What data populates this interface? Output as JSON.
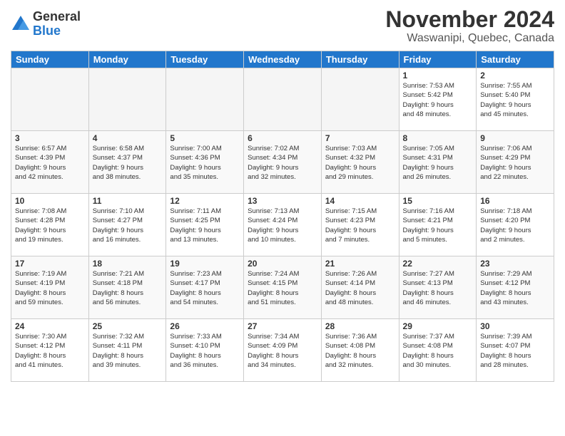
{
  "logo": {
    "general": "General",
    "blue": "Blue"
  },
  "title": "November 2024",
  "location": "Waswanipi, Quebec, Canada",
  "days_of_week": [
    "Sunday",
    "Monday",
    "Tuesday",
    "Wednesday",
    "Thursday",
    "Friday",
    "Saturday"
  ],
  "weeks": [
    [
      {
        "day": "",
        "info": ""
      },
      {
        "day": "",
        "info": ""
      },
      {
        "day": "",
        "info": ""
      },
      {
        "day": "",
        "info": ""
      },
      {
        "day": "",
        "info": ""
      },
      {
        "day": "1",
        "info": "Sunrise: 7:53 AM\nSunset: 5:42 PM\nDaylight: 9 hours\nand 48 minutes."
      },
      {
        "day": "2",
        "info": "Sunrise: 7:55 AM\nSunset: 5:40 PM\nDaylight: 9 hours\nand 45 minutes."
      }
    ],
    [
      {
        "day": "3",
        "info": "Sunrise: 6:57 AM\nSunset: 4:39 PM\nDaylight: 9 hours\nand 42 minutes."
      },
      {
        "day": "4",
        "info": "Sunrise: 6:58 AM\nSunset: 4:37 PM\nDaylight: 9 hours\nand 38 minutes."
      },
      {
        "day": "5",
        "info": "Sunrise: 7:00 AM\nSunset: 4:36 PM\nDaylight: 9 hours\nand 35 minutes."
      },
      {
        "day": "6",
        "info": "Sunrise: 7:02 AM\nSunset: 4:34 PM\nDaylight: 9 hours\nand 32 minutes."
      },
      {
        "day": "7",
        "info": "Sunrise: 7:03 AM\nSunset: 4:32 PM\nDaylight: 9 hours\nand 29 minutes."
      },
      {
        "day": "8",
        "info": "Sunrise: 7:05 AM\nSunset: 4:31 PM\nDaylight: 9 hours\nand 26 minutes."
      },
      {
        "day": "9",
        "info": "Sunrise: 7:06 AM\nSunset: 4:29 PM\nDaylight: 9 hours\nand 22 minutes."
      }
    ],
    [
      {
        "day": "10",
        "info": "Sunrise: 7:08 AM\nSunset: 4:28 PM\nDaylight: 9 hours\nand 19 minutes."
      },
      {
        "day": "11",
        "info": "Sunrise: 7:10 AM\nSunset: 4:27 PM\nDaylight: 9 hours\nand 16 minutes."
      },
      {
        "day": "12",
        "info": "Sunrise: 7:11 AM\nSunset: 4:25 PM\nDaylight: 9 hours\nand 13 minutes."
      },
      {
        "day": "13",
        "info": "Sunrise: 7:13 AM\nSunset: 4:24 PM\nDaylight: 9 hours\nand 10 minutes."
      },
      {
        "day": "14",
        "info": "Sunrise: 7:15 AM\nSunset: 4:23 PM\nDaylight: 9 hours\nand 7 minutes."
      },
      {
        "day": "15",
        "info": "Sunrise: 7:16 AM\nSunset: 4:21 PM\nDaylight: 9 hours\nand 5 minutes."
      },
      {
        "day": "16",
        "info": "Sunrise: 7:18 AM\nSunset: 4:20 PM\nDaylight: 9 hours\nand 2 minutes."
      }
    ],
    [
      {
        "day": "17",
        "info": "Sunrise: 7:19 AM\nSunset: 4:19 PM\nDaylight: 8 hours\nand 59 minutes."
      },
      {
        "day": "18",
        "info": "Sunrise: 7:21 AM\nSunset: 4:18 PM\nDaylight: 8 hours\nand 56 minutes."
      },
      {
        "day": "19",
        "info": "Sunrise: 7:23 AM\nSunset: 4:17 PM\nDaylight: 8 hours\nand 54 minutes."
      },
      {
        "day": "20",
        "info": "Sunrise: 7:24 AM\nSunset: 4:15 PM\nDaylight: 8 hours\nand 51 minutes."
      },
      {
        "day": "21",
        "info": "Sunrise: 7:26 AM\nSunset: 4:14 PM\nDaylight: 8 hours\nand 48 minutes."
      },
      {
        "day": "22",
        "info": "Sunrise: 7:27 AM\nSunset: 4:13 PM\nDaylight: 8 hours\nand 46 minutes."
      },
      {
        "day": "23",
        "info": "Sunrise: 7:29 AM\nSunset: 4:12 PM\nDaylight: 8 hours\nand 43 minutes."
      }
    ],
    [
      {
        "day": "24",
        "info": "Sunrise: 7:30 AM\nSunset: 4:12 PM\nDaylight: 8 hours\nand 41 minutes."
      },
      {
        "day": "25",
        "info": "Sunrise: 7:32 AM\nSunset: 4:11 PM\nDaylight: 8 hours\nand 39 minutes."
      },
      {
        "day": "26",
        "info": "Sunrise: 7:33 AM\nSunset: 4:10 PM\nDaylight: 8 hours\nand 36 minutes."
      },
      {
        "day": "27",
        "info": "Sunrise: 7:34 AM\nSunset: 4:09 PM\nDaylight: 8 hours\nand 34 minutes."
      },
      {
        "day": "28",
        "info": "Sunrise: 7:36 AM\nSunset: 4:08 PM\nDaylight: 8 hours\nand 32 minutes."
      },
      {
        "day": "29",
        "info": "Sunrise: 7:37 AM\nSunset: 4:08 PM\nDaylight: 8 hours\nand 30 minutes."
      },
      {
        "day": "30",
        "info": "Sunrise: 7:39 AM\nSunset: 4:07 PM\nDaylight: 8 hours\nand 28 minutes."
      }
    ]
  ]
}
